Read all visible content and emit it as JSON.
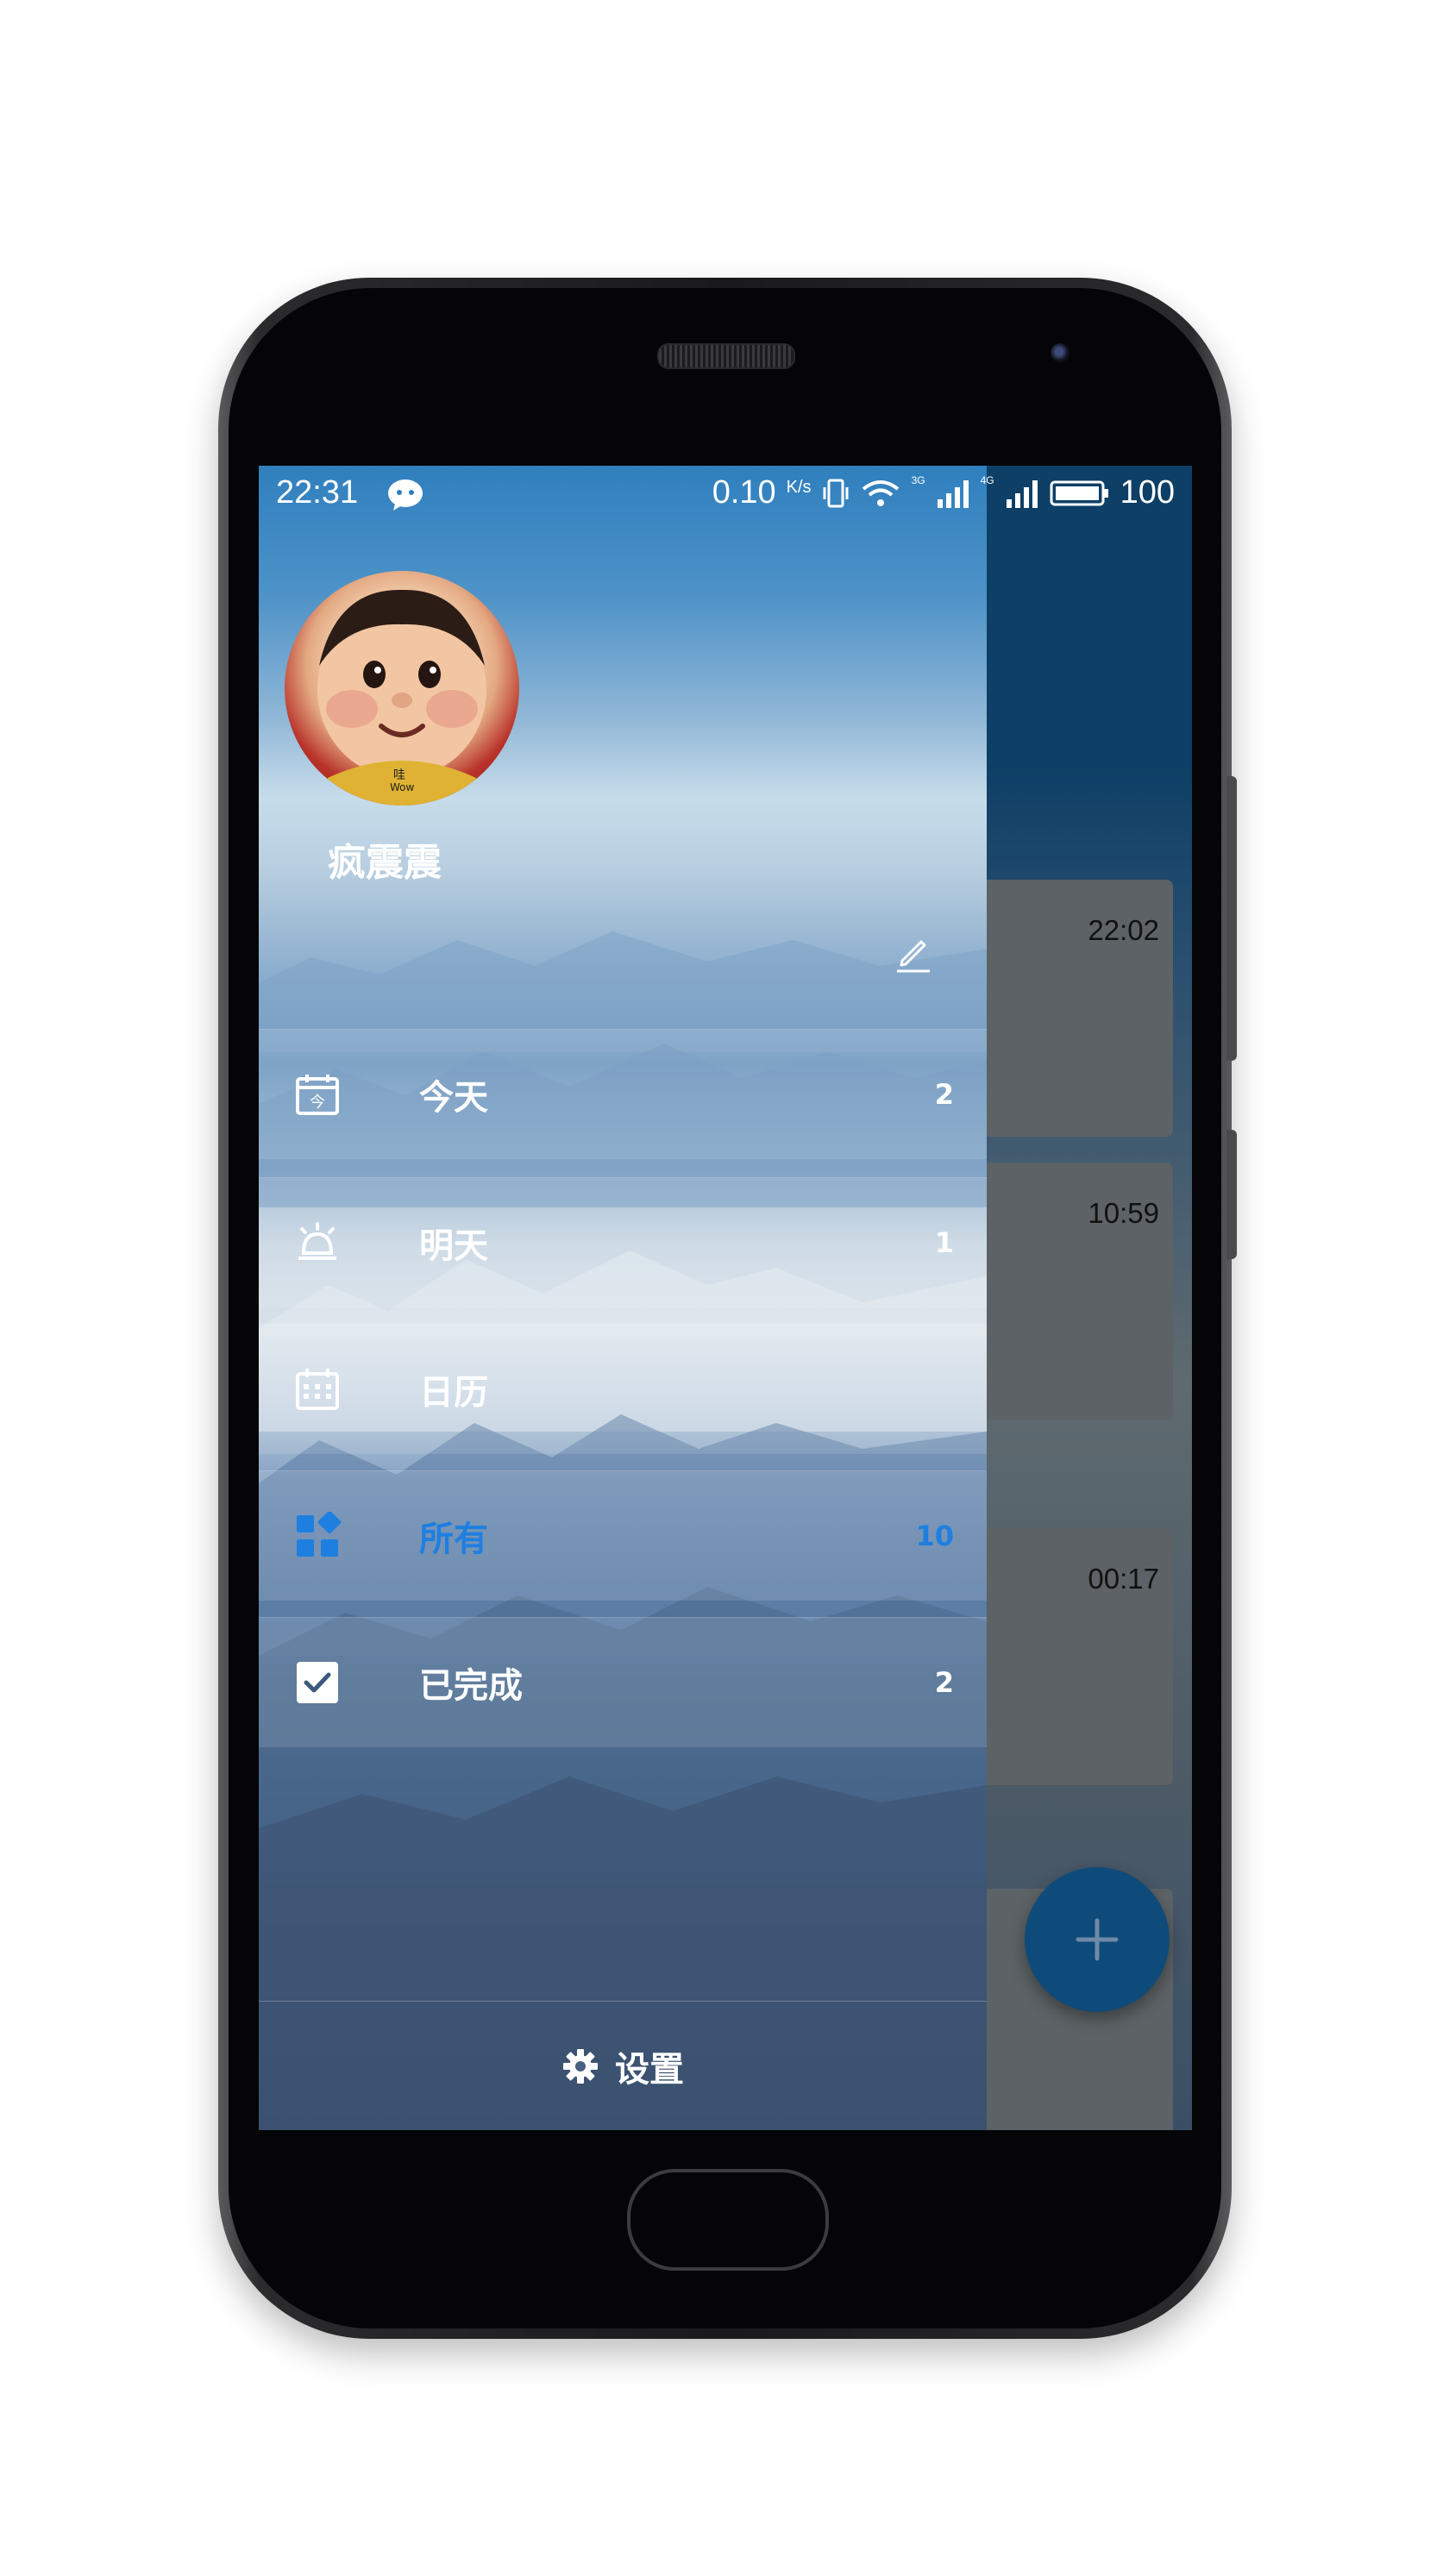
{
  "status_bar": {
    "time": "22:31",
    "net_speed": "0.10",
    "net_unit": "K/s",
    "sim1_label": "3G",
    "sim2_label": "4G",
    "battery": "100"
  },
  "profile": {
    "avatar_caption_cn": "哇",
    "avatar_caption_en": "Wow",
    "username": "疯震震"
  },
  "menu": [
    {
      "label": "今天",
      "count": "2",
      "icon": "calendar-today-icon",
      "active": false
    },
    {
      "label": "明天",
      "count": "1",
      "icon": "alarm-icon",
      "active": false
    },
    {
      "label": "日历",
      "count": "",
      "icon": "calendar-grid-icon",
      "active": false
    },
    {
      "label": "所有",
      "count": "10",
      "icon": "grid-apps-icon",
      "active": true
    },
    {
      "label": "已完成",
      "count": "2",
      "icon": "checkbox-icon",
      "active": false
    }
  ],
  "settings_label": "设置",
  "app_behind": {
    "cards": [
      {
        "time": "22:02"
      },
      {
        "time": "10:59"
      },
      {
        "time": "00:17"
      }
    ],
    "fab_icon": "plus-icon"
  },
  "colors": {
    "accent": "#1e7fe0",
    "app_bar": "#0e3f66",
    "fab": "#0f4b7a"
  }
}
